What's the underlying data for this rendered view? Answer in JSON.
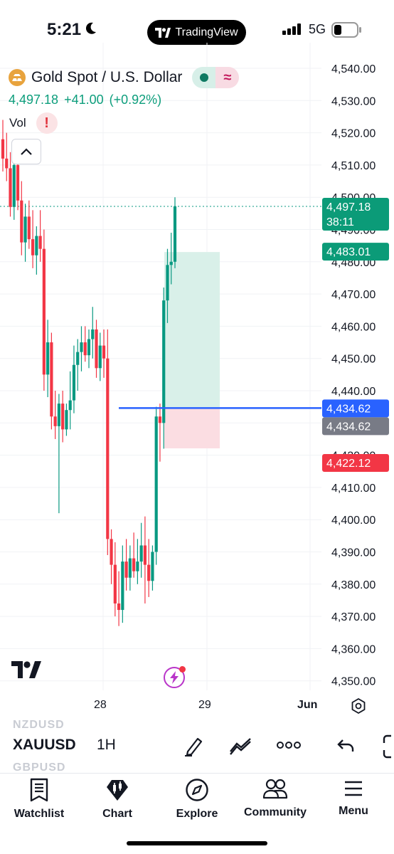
{
  "status_bar": {
    "time": "5:21",
    "network": "5G",
    "app_pill_label": "TradingView"
  },
  "header": {
    "symbol_name": "Gold Spot / U.S. Dollar",
    "last_price": "4,497.18",
    "change": "+41.00",
    "change_pct": "(+0.92%)",
    "vol_label": "Vol",
    "vol_alert": "!",
    "indicator_glyph": "≈"
  },
  "price_axis": {
    "labels": [
      "4,540.00",
      "4,530.00",
      "4,520.00",
      "4,510.00",
      "4,500.00",
      "4,490.00",
      "4,480.00",
      "4,470.00",
      "4,460.00",
      "4,450.00",
      "4,440.00",
      "4,430.00",
      "4,420.00",
      "4,410.00",
      "4,400.00",
      "4,390.00",
      "4,380.00",
      "4,370.00",
      "4,360.00",
      "4,350.00"
    ],
    "markers": [
      {
        "id": "last",
        "value": 4497.18,
        "text": "4,497.18",
        "sub": "38:11",
        "color": "#0b9b78"
      },
      {
        "id": "target",
        "value": 4483.01,
        "text": "4,483.01",
        "color": "#0b9b78"
      },
      {
        "id": "entry-line",
        "value": 4434.62,
        "text": "4,434.62",
        "color": "#2962ff"
      },
      {
        "id": "entry",
        "value": 4434.62,
        "text": "4,434.62",
        "color": "#787b86"
      },
      {
        "id": "stop",
        "value": 4422.12,
        "text": "4,422.12",
        "color": "#f23645"
      }
    ]
  },
  "time_axis": {
    "labels": [
      "28",
      "29",
      "Jun"
    ]
  },
  "toolbar": {
    "symbol_prev": "NZDUSD",
    "symbol_current": "XAUUSD",
    "symbol_next": "GBPUSD",
    "interval": "1H"
  },
  "bottom_nav": {
    "items": [
      "Watchlist",
      "Chart",
      "Explore",
      "Community",
      "Menu"
    ]
  },
  "colors": {
    "up": "#089981",
    "down": "#f23645",
    "accent": "#2962ff"
  },
  "chart_data": {
    "type": "candlestick",
    "symbol": "XAUUSD",
    "interval": "1H",
    "ylim": [
      4345,
      4545
    ],
    "candles": [
      {
        "o": 4518,
        "h": 4524,
        "l": 4508,
        "c": 4512
      },
      {
        "o": 4512,
        "h": 4520,
        "l": 4505,
        "c": 4509
      },
      {
        "o": 4509,
        "h": 4514,
        "l": 4494,
        "c": 4497
      },
      {
        "o": 4497,
        "h": 4515,
        "l": 4493,
        "c": 4510
      },
      {
        "o": 4510,
        "h": 4514,
        "l": 4496,
        "c": 4499
      },
      {
        "o": 4499,
        "h": 4505,
        "l": 4482,
        "c": 4486
      },
      {
        "o": 4486,
        "h": 4498,
        "l": 4480,
        "c": 4494
      },
      {
        "o": 4494,
        "h": 4499,
        "l": 4484,
        "c": 4487
      },
      {
        "o": 4487,
        "h": 4496,
        "l": 4478,
        "c": 4482
      },
      {
        "o": 4482,
        "h": 4491,
        "l": 4476,
        "c": 4488
      },
      {
        "o": 4488,
        "h": 4496,
        "l": 4480,
        "c": 4484
      },
      {
        "o": 4484,
        "h": 4490,
        "l": 4440,
        "c": 4445
      },
      {
        "o": 4445,
        "h": 4462,
        "l": 4438,
        "c": 4455
      },
      {
        "o": 4455,
        "h": 4458,
        "l": 4428,
        "c": 4432
      },
      {
        "o": 4432,
        "h": 4440,
        "l": 4425,
        "c": 4429
      },
      {
        "o": 4429,
        "h": 4439,
        "l": 4402,
        "c": 4436
      },
      {
        "o": 4436,
        "h": 4440,
        "l": 4424,
        "c": 4428
      },
      {
        "o": 4428,
        "h": 4436,
        "l": 4426,
        "c": 4434
      },
      {
        "o": 4434,
        "h": 4446,
        "l": 4428,
        "c": 4437
      },
      {
        "o": 4437,
        "h": 4454,
        "l": 4433,
        "c": 4448
      },
      {
        "o": 4448,
        "h": 4456,
        "l": 4440,
        "c": 4452
      },
      {
        "o": 4452,
        "h": 4460,
        "l": 4446,
        "c": 4455
      },
      {
        "o": 4455,
        "h": 4460,
        "l": 4449,
        "c": 4451
      },
      {
        "o": 4451,
        "h": 4459,
        "l": 4447,
        "c": 4456
      },
      {
        "o": 4456,
        "h": 4466,
        "l": 4450,
        "c": 4459
      },
      {
        "o": 4459,
        "h": 4462,
        "l": 4444,
        "c": 4447
      },
      {
        "o": 4447,
        "h": 4458,
        "l": 4443,
        "c": 4454
      },
      {
        "o": 4454,
        "h": 4459,
        "l": 4444,
        "c": 4450
      },
      {
        "o": 4450,
        "h": 4459,
        "l": 4389,
        "c": 4394
      },
      {
        "o": 4394,
        "h": 4397,
        "l": 4380,
        "c": 4386
      },
      {
        "o": 4386,
        "h": 4393,
        "l": 4370,
        "c": 4374
      },
      {
        "o": 4374,
        "h": 4384,
        "l": 4367,
        "c": 4372
      },
      {
        "o": 4372,
        "h": 4392,
        "l": 4368,
        "c": 4387
      },
      {
        "o": 4387,
        "h": 4394,
        "l": 4378,
        "c": 4382
      },
      {
        "o": 4382,
        "h": 4392,
        "l": 4378,
        "c": 4388
      },
      {
        "o": 4388,
        "h": 4396,
        "l": 4382,
        "c": 4384
      },
      {
        "o": 4384,
        "h": 4394,
        "l": 4380,
        "c": 4387
      },
      {
        "o": 4387,
        "h": 4399,
        "l": 4382,
        "c": 4392
      },
      {
        "o": 4392,
        "h": 4401,
        "l": 4374,
        "c": 4386
      },
      {
        "o": 4386,
        "h": 4394,
        "l": 4376,
        "c": 4381
      },
      {
        "o": 4381,
        "h": 4392,
        "l": 4378,
        "c": 4390
      },
      {
        "o": 4390,
        "h": 4435,
        "l": 4386,
        "c": 4432
      },
      {
        "o": 4432,
        "h": 4436,
        "l": 4418,
        "c": 4430
      },
      {
        "o": 4430,
        "h": 4472,
        "l": 4422,
        "c": 4468
      },
      {
        "o": 4468,
        "h": 4484,
        "l": 4461,
        "c": 4479
      },
      {
        "o": 4479,
        "h": 4489,
        "l": 4473,
        "c": 4480
      },
      {
        "o": 4480,
        "h": 4500,
        "l": 4478,
        "c": 4497.18
      }
    ],
    "horizontal_line": 4434.62,
    "position": {
      "entry": 4434.62,
      "target": 4483.01,
      "stop": 4422.12
    },
    "x_ticks": [
      "28",
      "29",
      "Jun"
    ]
  }
}
